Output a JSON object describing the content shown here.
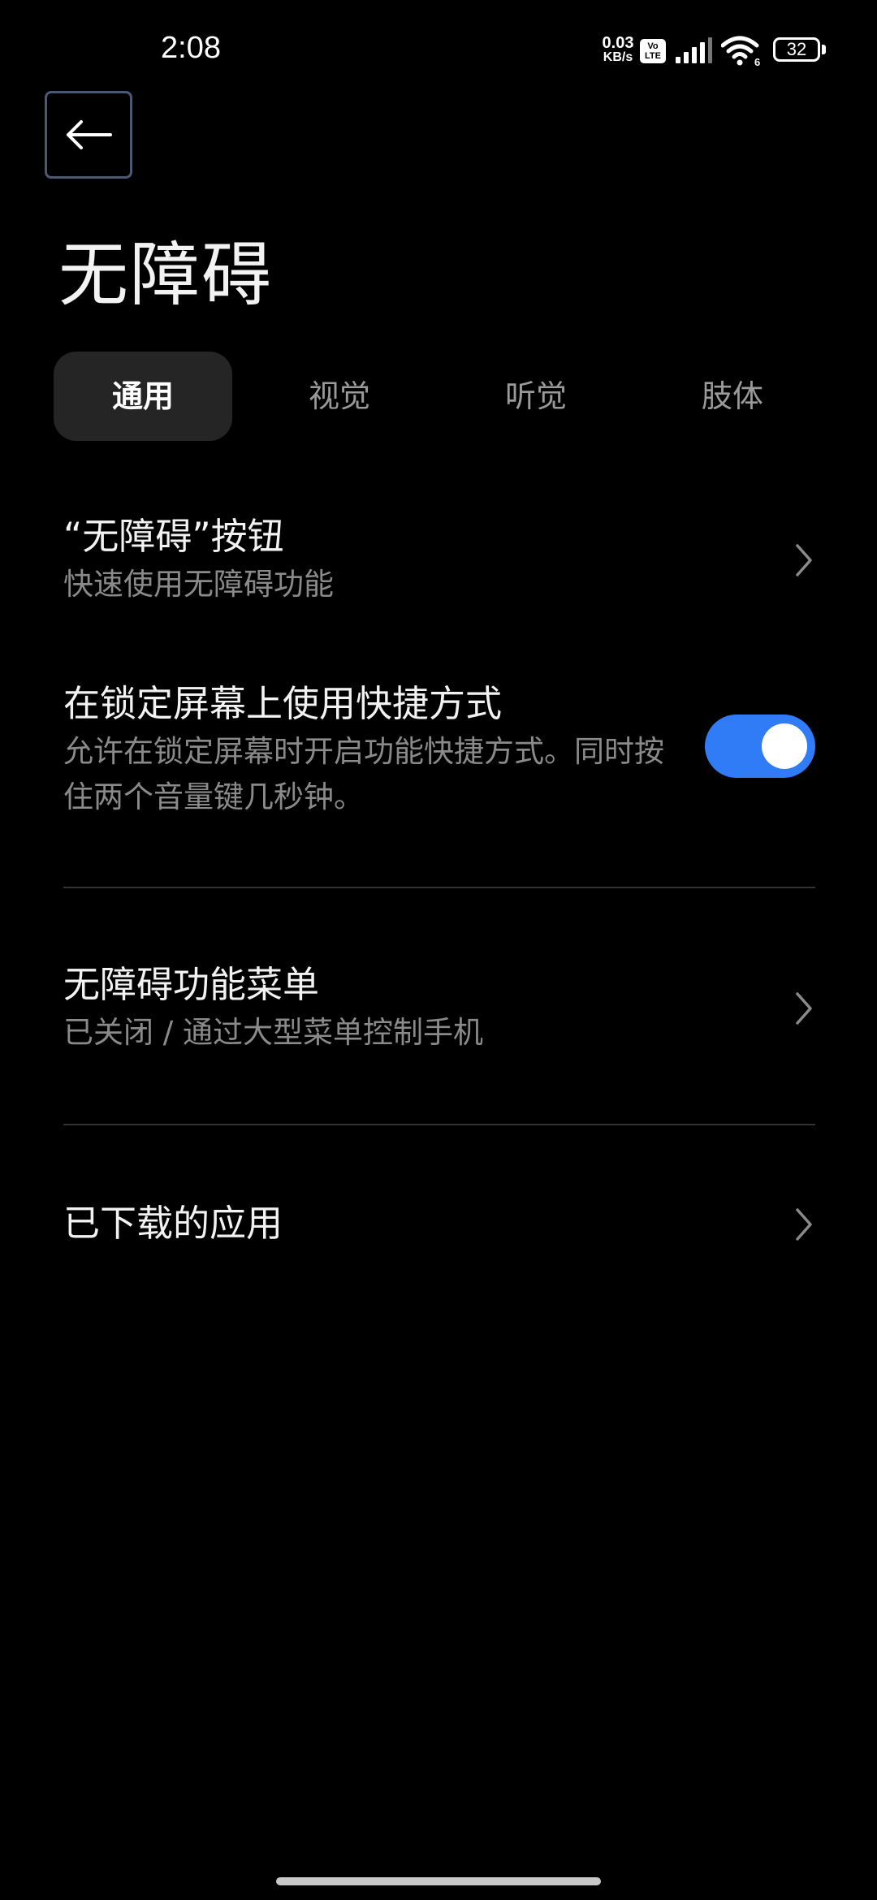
{
  "status_bar": {
    "time": "2:08",
    "net_speed_value": "0.03",
    "net_speed_unit": "KB/s",
    "volte_line1": "Vo",
    "volte_line2": "LTE",
    "wifi_badge": "6",
    "battery": "32"
  },
  "header": {
    "title": "无障碍"
  },
  "tabs": [
    {
      "label": "通用",
      "active": true
    },
    {
      "label": "视觉",
      "active": false
    },
    {
      "label": "听觉",
      "active": false
    },
    {
      "label": "肢体",
      "active": false
    }
  ],
  "items": {
    "accessibility_button": {
      "title": "“无障碍”按钮",
      "subtitle": "快速使用无障碍功能"
    },
    "lock_screen_shortcut": {
      "title": "在锁定屏幕上使用快捷方式",
      "subtitle": "允许在锁定屏幕时开启功能快捷方式。同时按住两个音量键几秒钟。",
      "enabled": true
    },
    "accessibility_menu": {
      "title": "无障碍功能菜单",
      "subtitle": "已关闭 / 通过大型菜单控制手机"
    },
    "downloaded_apps": {
      "title": "已下载的应用"
    }
  },
  "colors": {
    "background": "#000000",
    "toggle_on": "#2f7cf6",
    "active_tab_bg": "#252525",
    "subtitle": "#8a8a8a"
  },
  "icons": {
    "back": "arrow-left-icon",
    "chevron": "chevron-right-icon"
  }
}
